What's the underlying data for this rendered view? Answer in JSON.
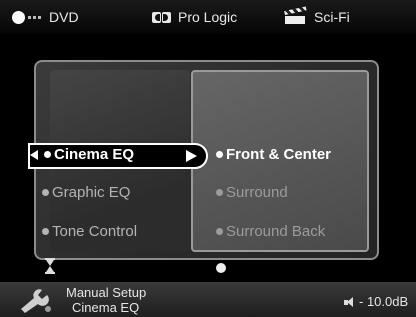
{
  "topbar": {
    "source": "DVD",
    "decoder": "Pro Logic",
    "mode": "Sci-Fi"
  },
  "menu": {
    "left_items": [
      {
        "label": "Cinema EQ",
        "selected": true
      },
      {
        "label": "Graphic EQ",
        "selected": false
      },
      {
        "label": "Tone Control",
        "selected": false
      }
    ],
    "right_items": [
      {
        "label": "Front & Center",
        "active": true
      },
      {
        "label": "Surround",
        "active": false
      },
      {
        "label": "Surround Back",
        "active": false
      }
    ]
  },
  "footer": {
    "title": "Manual Setup",
    "subtitle": "Cinema EQ",
    "volume": "- 10.0dB"
  },
  "icons": {
    "source": "disc-icon",
    "decoder": "dolby-icon",
    "mode": "clapperboard-icon",
    "footer": "wrench-icon",
    "volume": "speaker-icon"
  }
}
